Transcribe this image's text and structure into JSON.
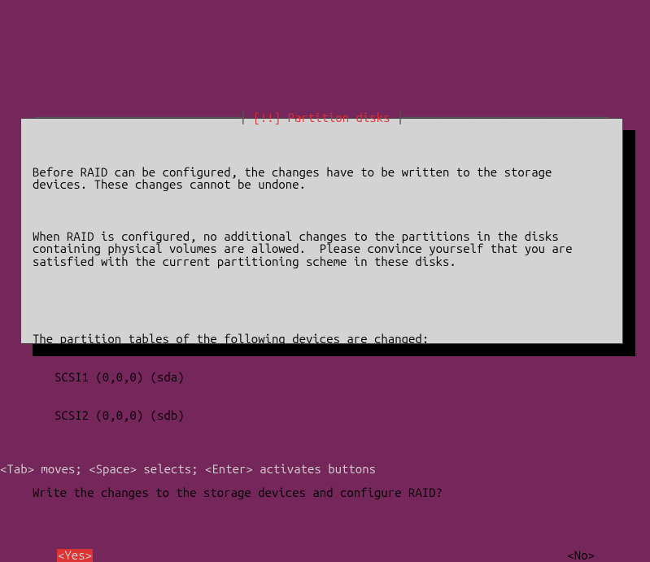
{
  "dialog": {
    "title_prefix": "[!!] ",
    "title": "Partition disks",
    "para1": "Before RAID can be configured, the changes have to be written to the storage devices. These changes cannot be undone.",
    "para2": "When RAID is configured, no additional changes to the partitions in the disks containing physical volumes are allowed.  Please convince yourself that you are satisfied with the current partitioning scheme in these disks.",
    "para3_intro": "The partition tables of the following devices are changed:",
    "devices": [
      "SCSI1 (0,0,0) (sda)",
      "SCSI2 (0,0,0) (sdb)"
    ],
    "question": "Write the changes to the storage devices and configure RAID?",
    "yes_label": "<Yes>",
    "no_label": "<No>"
  },
  "helpbar": "<Tab> moves; <Space> selects; <Enter> activates buttons"
}
